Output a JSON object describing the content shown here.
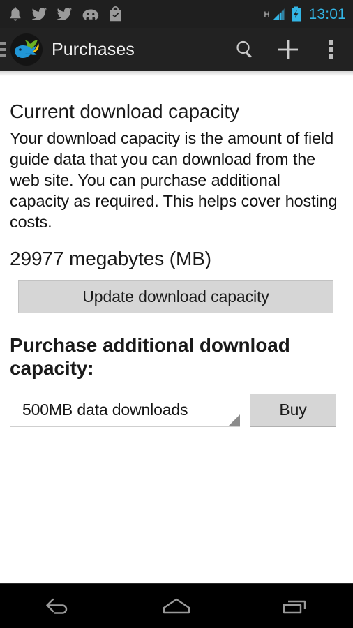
{
  "status_bar": {
    "notifications": [
      {
        "name": "notification-bell-icon",
        "label": "bell"
      },
      {
        "name": "twitter-icon-1",
        "label": "twitter"
      },
      {
        "name": "twitter-icon-2",
        "label": "twitter"
      },
      {
        "name": "android-icon",
        "label": "android"
      },
      {
        "name": "shopping-bag-check-icon",
        "label": "store-update"
      }
    ],
    "network_type": "H",
    "signal_icon": "signal-bars-icon",
    "battery_icon": "battery-charging-icon",
    "time": "13:01",
    "time_color": "#33b5e5",
    "background": "#1f1f1f"
  },
  "action_bar": {
    "drawer_indicator": "hamburger-menu-icon",
    "app_icon": "app-logo-fish-leaf-icon",
    "title": "Purchases",
    "background": "#222222",
    "actions": [
      {
        "name": "search-button",
        "icon": "search-icon",
        "label": "Search"
      },
      {
        "name": "add-button",
        "icon": "plus-icon",
        "label": "Add"
      },
      {
        "name": "overflow-button",
        "icon": "overflow-menu-icon",
        "label": "More options"
      }
    ]
  },
  "main": {
    "current_capacity_heading": "Current download capacity",
    "description": "Your download capacity is the amount of field guide data that you can download from the web site.  You can purchase additional capacity as required. This helps cover hosting costs.",
    "capacity_value": "29977 megabytes (MB)",
    "update_button_label": "Update download capacity",
    "purchase_heading": "Purchase additional download capacity:",
    "spinner": {
      "selected": "500MB data downloads",
      "caret_icon": "spinner-caret-icon"
    },
    "buy_button_label": "Buy",
    "button_face": "#d6d6d6",
    "button_border": "#c2c2c2"
  },
  "nav_bar": {
    "background": "#000000",
    "buttons": [
      {
        "name": "nav-back-button",
        "icon": "back-arrow-icon",
        "label": "Back"
      },
      {
        "name": "nav-home-button",
        "icon": "home-icon",
        "label": "Home"
      },
      {
        "name": "nav-recents-button",
        "icon": "recent-apps-icon",
        "label": "Recent apps"
      }
    ]
  }
}
